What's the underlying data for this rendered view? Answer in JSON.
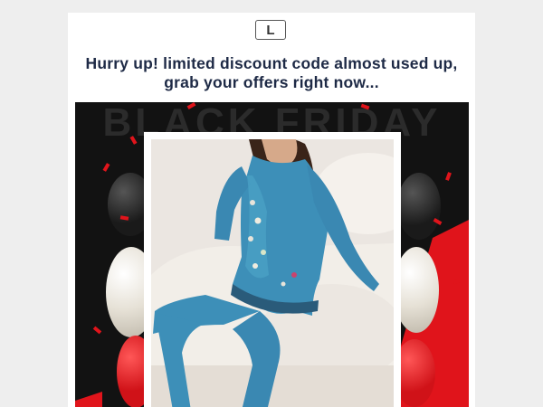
{
  "email": {
    "logo_letter": "L",
    "headline_line1": "Hurry up! limited discount code almost used up,",
    "headline_line2": "grab your offers right now...",
    "banner_text": "BLACK FRIDAY"
  },
  "colors": {
    "background": "#eeeeee",
    "headline": "#1e2a46",
    "banner_bg": "#121212",
    "accent_red": "#e0141b",
    "outfit_blue": "#3d8fb8"
  },
  "icons": [
    "logo-icon",
    "balloon-icon",
    "confetti-icon"
  ]
}
